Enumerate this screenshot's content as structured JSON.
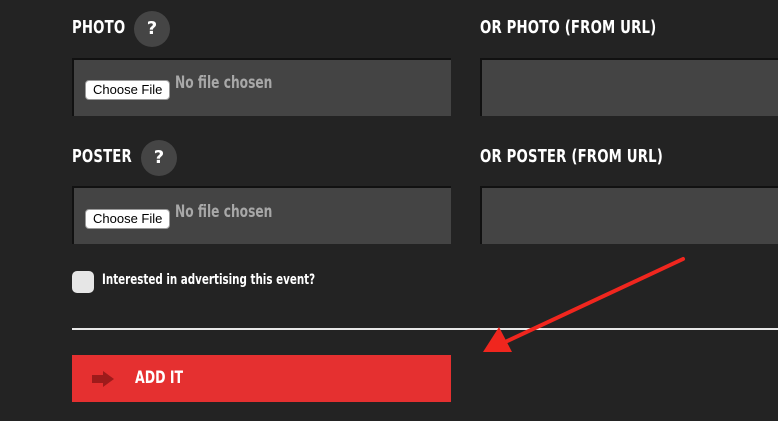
{
  "photo": {
    "label": "PHOTO",
    "help": "?",
    "choose_button": "Choose File",
    "no_file": "No file chosen",
    "url_label": "OR PHOTO (FROM URL)",
    "url_value": ""
  },
  "poster": {
    "label": "POSTER",
    "help": "?",
    "choose_button": "Choose File",
    "no_file": "No file chosen",
    "url_label": "OR POSTER (FROM URL)",
    "url_value": ""
  },
  "advertising": {
    "label": "Interested in advertising this event?",
    "checked": false
  },
  "submit": {
    "label": "ADD IT",
    "icon": "arrow-right-icon"
  },
  "annotation": {
    "icon": "red-arrow-annotation",
    "color": "#f0261e"
  },
  "colors": {
    "background": "#232323",
    "field": "#444444",
    "accent": "#e53030"
  }
}
